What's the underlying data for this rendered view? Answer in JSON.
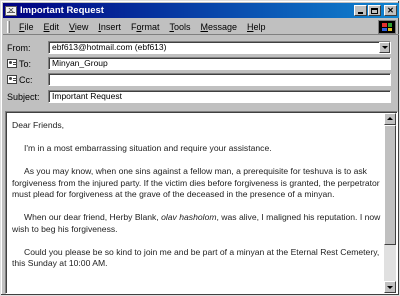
{
  "window": {
    "title": "Important Request"
  },
  "menu": [
    {
      "underline": "F",
      "rest": "ile"
    },
    {
      "underline": "E",
      "rest": "dit"
    },
    {
      "underline": "V",
      "rest": "iew"
    },
    {
      "underline": "I",
      "rest": "nsert"
    },
    {
      "pre": "F",
      "underline": "o",
      "rest": "rmat"
    },
    {
      "underline": "T",
      "rest": "ools"
    },
    {
      "underline": "M",
      "rest": "essage"
    },
    {
      "underline": "H",
      "rest": "elp"
    }
  ],
  "header": {
    "from_label": "From:",
    "from_value": "ebf613@hotmail.com   (ebf613)",
    "to_label": "To:",
    "to_value": "Minyan_Group",
    "cc_label": "Cc:",
    "cc_value": "",
    "subject_label": "Subject:",
    "subject_value": "Important Request"
  },
  "body": {
    "greeting": "Dear Friends,",
    "p1": "I'm in a most embarrassing situation and require your assistance.",
    "p2": "As you may know, when one sins against a fellow man, a prerequisite for teshuva is to ask forgiveness from the injured party. If the victim dies before forgiveness is granted, the perpetrator must plead for forgiveness at the grave of the deceased in the presence of a minyan.",
    "p3_before": "When our dear friend, Herby Blank, ",
    "p3_italic": "olav hasholom",
    "p3_after": ", was alive, I maligned his reputation. I now wish to beg his forgiveness.",
    "p4": "Could you please be so kind to join me and be part of a minyan at the Eternal Rest Cemetery, this Sunday at 10:00 AM."
  }
}
